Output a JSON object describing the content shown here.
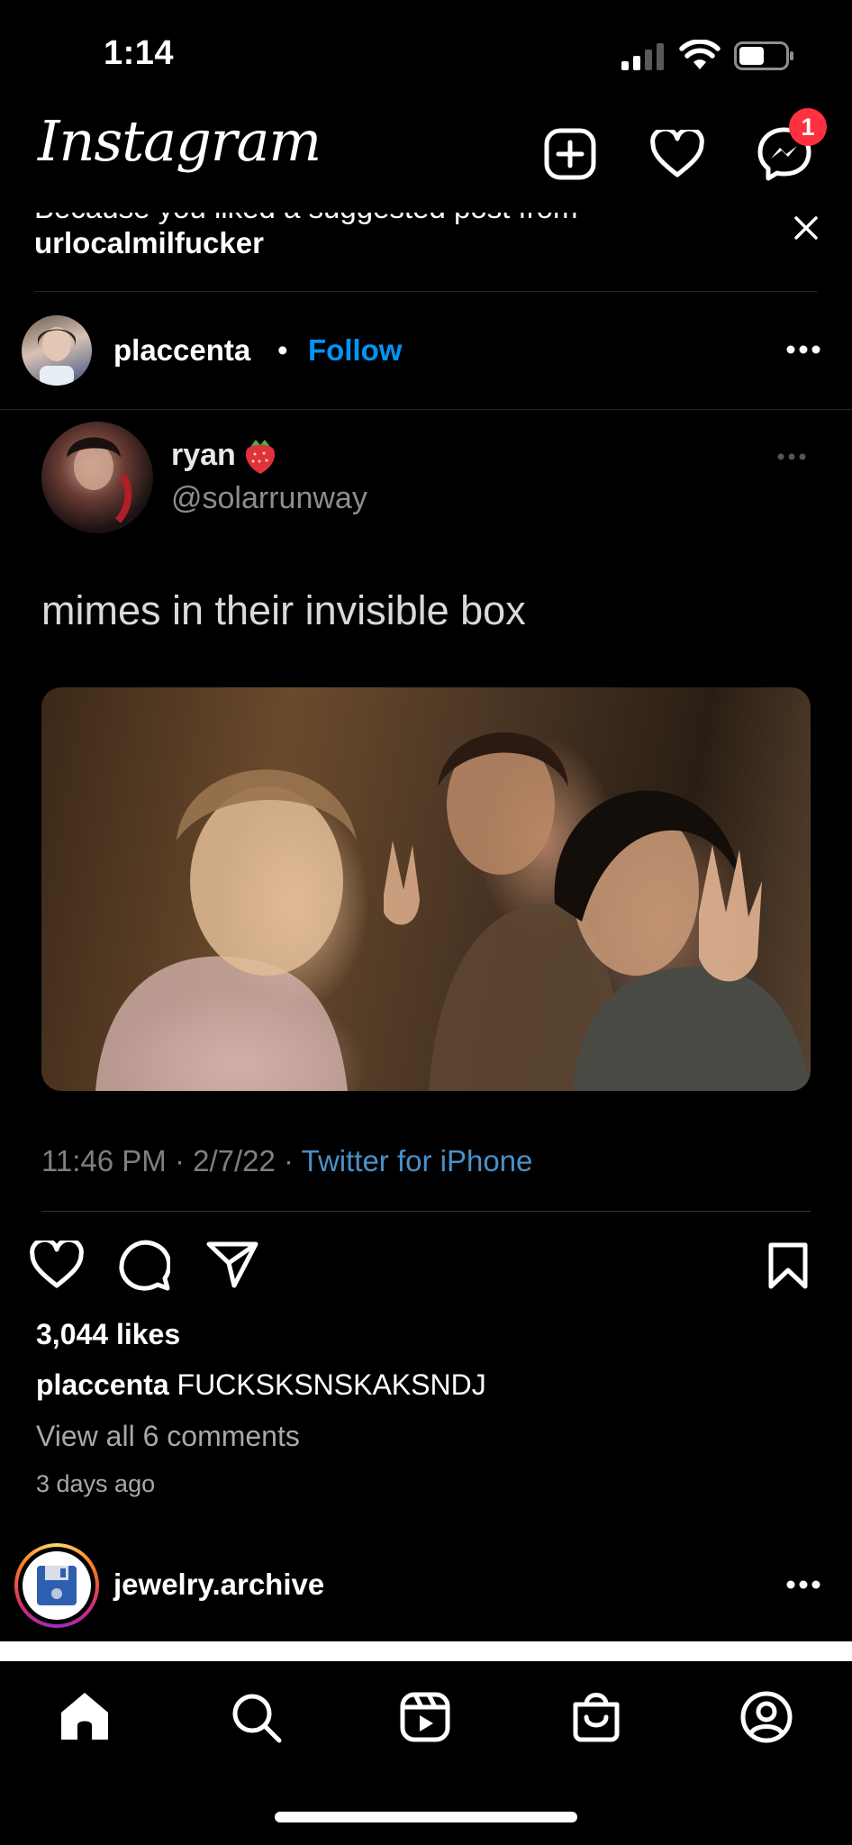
{
  "status_bar": {
    "time": "1:14"
  },
  "header": {
    "logo": "Instagram",
    "messenger_badge": "1"
  },
  "suggestion": {
    "line1": "Because you liked a suggested post from",
    "username": "urlocalmilfucker"
  },
  "post": {
    "username": "placcenta",
    "separator": "•",
    "follow_label": "Follow",
    "tweet": {
      "name": "ryan",
      "handle": "@solarrunway",
      "text": "mimes in their invisible box",
      "timestamp": "11:46 PM · 2/7/22 · ",
      "source": "Twitter for iPhone"
    },
    "likes": "3,044 likes",
    "caption_user": "placcenta",
    "caption_text": "FUCKSKSNSKAKSNDJ",
    "view_comments": "View all 6 comments",
    "time_ago": "3 days ago"
  },
  "next_post": {
    "username": "jewelry.archive"
  },
  "colors": {
    "follow": "#0095f6",
    "badge": "#ff3040",
    "tweet_source": "#4a90c9"
  },
  "icons": {
    "header": [
      "new-post-icon",
      "heart-icon",
      "messenger-icon"
    ],
    "actions": [
      "like-icon",
      "comment-icon",
      "share-icon",
      "save-icon"
    ],
    "nav": [
      "home-icon",
      "search-icon",
      "reels-icon",
      "shop-icon",
      "profile-icon"
    ]
  }
}
